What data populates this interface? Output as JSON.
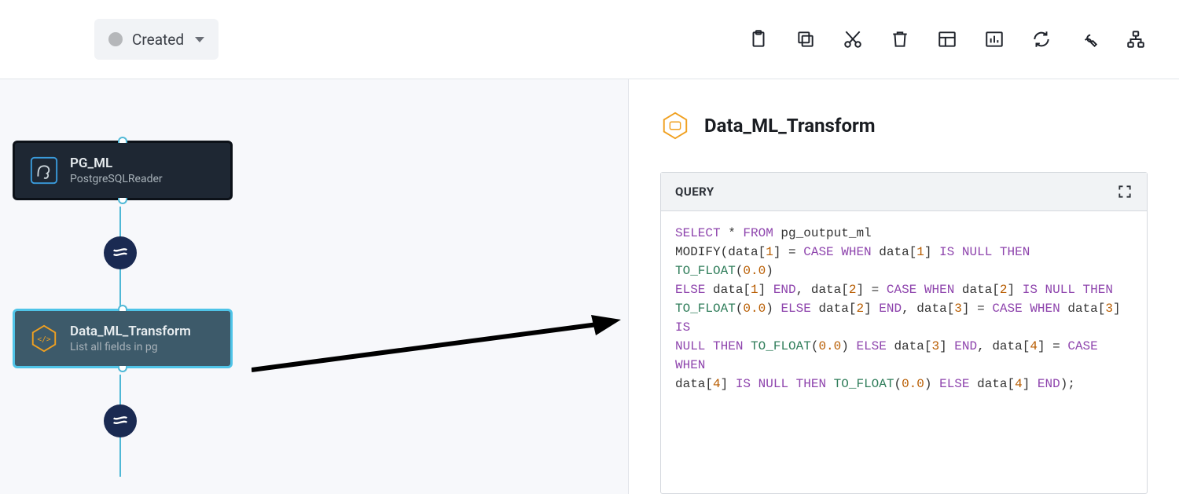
{
  "status": {
    "label": "Created"
  },
  "toolbar": [
    {
      "name": "clipboard-icon"
    },
    {
      "name": "copy-icon"
    },
    {
      "name": "cut-icon"
    },
    {
      "name": "delete-icon"
    },
    {
      "name": "layout-icon"
    },
    {
      "name": "chart-icon"
    },
    {
      "name": "refresh-icon"
    },
    {
      "name": "wrench-icon"
    },
    {
      "name": "hierarchy-icon"
    }
  ],
  "nodes": {
    "pg": {
      "title": "PG_ML",
      "subtitle": "PostgreSQLReader"
    },
    "transform": {
      "title": "Data_ML_Transform",
      "subtitle": "List all fields in pg"
    }
  },
  "panel": {
    "title": "Data_ML_Transform",
    "query_label": "QUERY",
    "query": {
      "tokens": [
        {
          "t": "SELECT",
          "c": "kw"
        },
        {
          "t": " * "
        },
        {
          "t": "FROM",
          "c": "kw"
        },
        {
          "t": " pg_output_ml"
        },
        {
          "t": "\n"
        },
        {
          "t": "MODIFY(data["
        },
        {
          "t": "1",
          "c": "lit"
        },
        {
          "t": "] = "
        },
        {
          "t": "CASE WHEN",
          "c": "kw"
        },
        {
          "t": " data["
        },
        {
          "t": "1",
          "c": "lit"
        },
        {
          "t": "] "
        },
        {
          "t": "IS NULL THEN",
          "c": "kw"
        },
        {
          "t": " "
        },
        {
          "t": "TO_FLOAT",
          "c": "fn"
        },
        {
          "t": "("
        },
        {
          "t": "0.0",
          "c": "lit"
        },
        {
          "t": ")"
        },
        {
          "t": "\n"
        },
        {
          "t": "ELSE",
          "c": "kw"
        },
        {
          "t": " data["
        },
        {
          "t": "1",
          "c": "lit"
        },
        {
          "t": "] "
        },
        {
          "t": "END",
          "c": "kw"
        },
        {
          "t": ", data["
        },
        {
          "t": "2",
          "c": "lit"
        },
        {
          "t": "] = "
        },
        {
          "t": "CASE WHEN",
          "c": "kw"
        },
        {
          "t": " data["
        },
        {
          "t": "2",
          "c": "lit"
        },
        {
          "t": "] "
        },
        {
          "t": "IS NULL THEN",
          "c": "kw"
        },
        {
          "t": "\n"
        },
        {
          "t": "TO_FLOAT",
          "c": "fn"
        },
        {
          "t": "("
        },
        {
          "t": "0.0",
          "c": "lit"
        },
        {
          "t": ") "
        },
        {
          "t": "ELSE",
          "c": "kw"
        },
        {
          "t": " data["
        },
        {
          "t": "2",
          "c": "lit"
        },
        {
          "t": "] "
        },
        {
          "t": "END",
          "c": "kw"
        },
        {
          "t": ", data["
        },
        {
          "t": "3",
          "c": "lit"
        },
        {
          "t": "] = "
        },
        {
          "t": "CASE WHEN",
          "c": "kw"
        },
        {
          "t": " data["
        },
        {
          "t": "3",
          "c": "lit"
        },
        {
          "t": "] "
        },
        {
          "t": "IS",
          "c": "kw"
        },
        {
          "t": "\n"
        },
        {
          "t": "NULL THEN",
          "c": "kw"
        },
        {
          "t": " "
        },
        {
          "t": "TO_FLOAT",
          "c": "fn"
        },
        {
          "t": "("
        },
        {
          "t": "0.0",
          "c": "lit"
        },
        {
          "t": ") "
        },
        {
          "t": "ELSE",
          "c": "kw"
        },
        {
          "t": " data["
        },
        {
          "t": "3",
          "c": "lit"
        },
        {
          "t": "] "
        },
        {
          "t": "END",
          "c": "kw"
        },
        {
          "t": ", data["
        },
        {
          "t": "4",
          "c": "lit"
        },
        {
          "t": "] = "
        },
        {
          "t": "CASE WHEN",
          "c": "kw"
        },
        {
          "t": "\n"
        },
        {
          "t": "data["
        },
        {
          "t": "4",
          "c": "lit"
        },
        {
          "t": "] "
        },
        {
          "t": "IS NULL THEN",
          "c": "kw"
        },
        {
          "t": " "
        },
        {
          "t": "TO_FLOAT",
          "c": "fn"
        },
        {
          "t": "("
        },
        {
          "t": "0.0",
          "c": "lit"
        },
        {
          "t": ") "
        },
        {
          "t": "ELSE",
          "c": "kw"
        },
        {
          "t": " data["
        },
        {
          "t": "4",
          "c": "lit"
        },
        {
          "t": "] "
        },
        {
          "t": "END",
          "c": "kw"
        },
        {
          "t": ");"
        }
      ]
    }
  }
}
